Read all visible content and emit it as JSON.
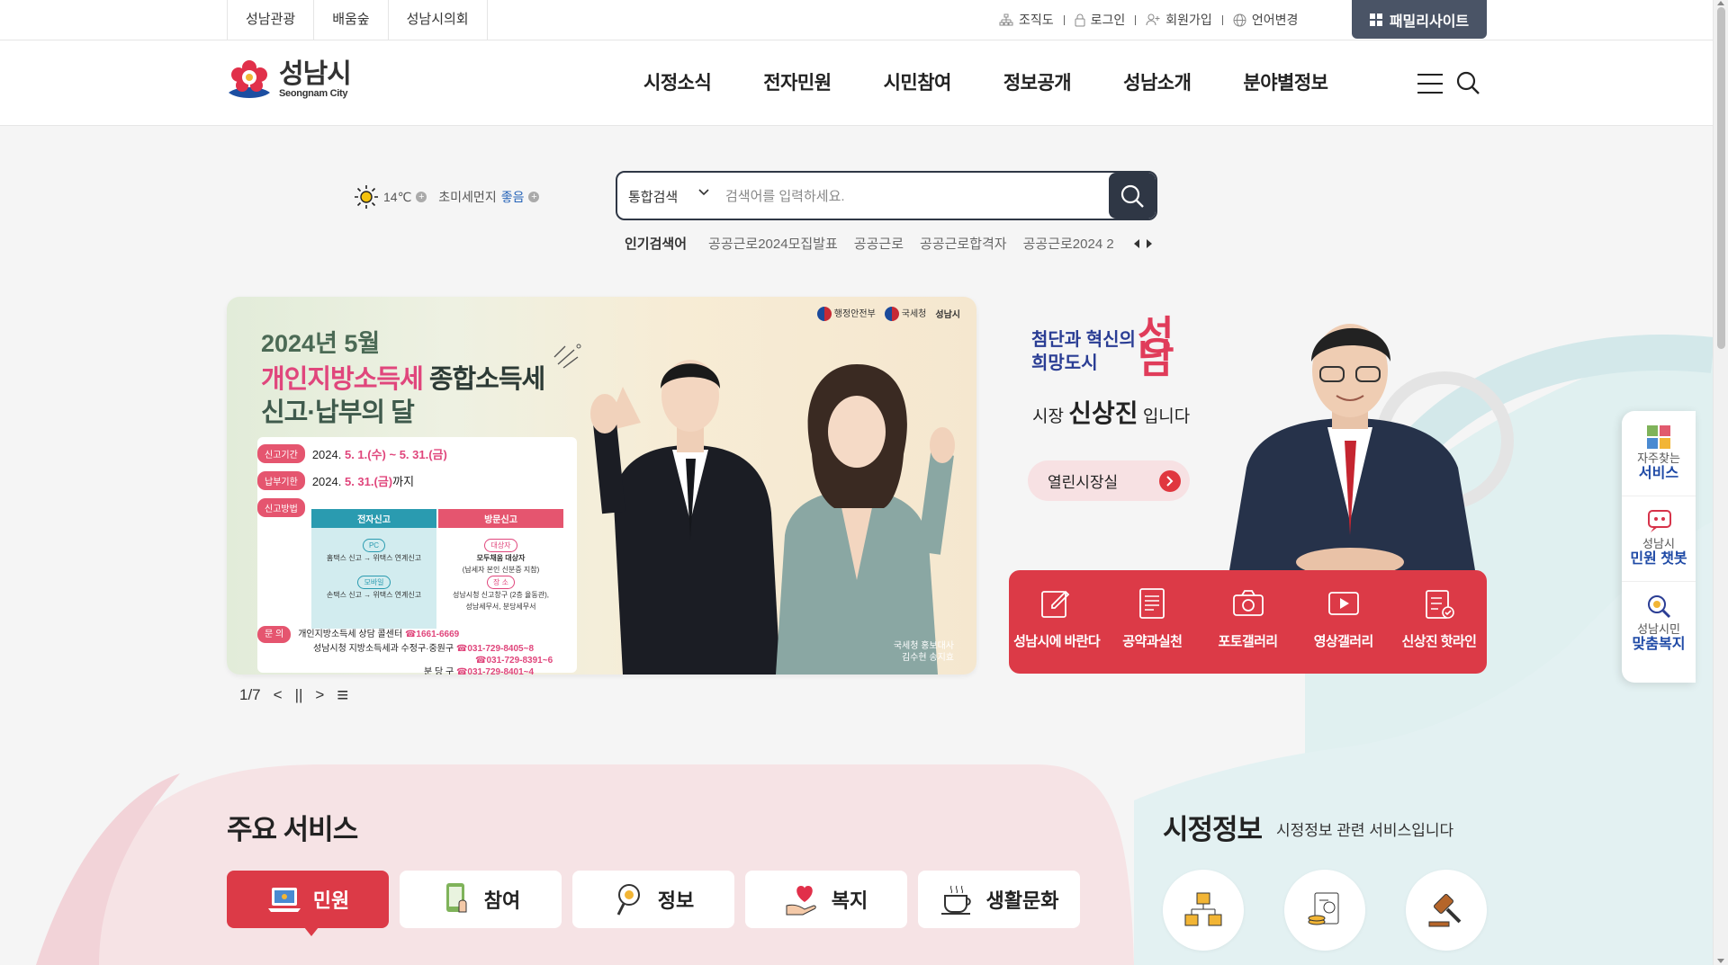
{
  "top_links": [
    "성남관광",
    "배움숲",
    "성남시의회"
  ],
  "utility": {
    "org": "조직도",
    "login": "로그인",
    "join": "회원가입",
    "language": "언어변경",
    "family_site": "패밀리사이트"
  },
  "logo": {
    "ko": "성남시",
    "en": "Seongnam City"
  },
  "gnb": [
    "시정소식",
    "전자민원",
    "시민참여",
    "정보공개",
    "성남소개",
    "분야별정보"
  ],
  "weather": {
    "temp": "14℃",
    "dust_label": "초미세먼지",
    "dust_value": "좋음"
  },
  "search": {
    "scope": "통합검색",
    "placeholder": "검색어를 입력하세요.",
    "popular_label": "인기검색어",
    "popular": [
      "공공근로2024모집발표",
      "공공근로",
      "공공근로합격자",
      "공공근로2024 2"
    ]
  },
  "banner": {
    "logos": [
      "행정안전부",
      "국세청",
      "성남시"
    ],
    "year": "2024년 5월",
    "title_hl": "개인지방소득세",
    "title_rest": " 종합소득세",
    "title2": "신고·납부의 달",
    "row1_tag": "신고기간",
    "row1_pre": "2024. ",
    "row1_hl": "5. 1.(수) ~ 5. 31.(금)",
    "row2_tag": "납부기한",
    "row2_pre": "2024. ",
    "row2_hl": "5. 31.(금)",
    "row2_post": "까지",
    "row3_tag": "신고방법",
    "col1_head": "전자신고",
    "col2_head": "방문신고",
    "col1_pc": "PC",
    "col1_pc_text": "홈택스 신고 → 위택스 연계신고",
    "col1_mobile": "모바일",
    "col1_mobile_text": "손택스 신고 → 위택스 연계신고",
    "col2_target": "대상자",
    "col2_target_text1": "모두채움 대상자",
    "col2_target_text2": "(납세자 본인 신분증 지참)",
    "col2_place": "장 소",
    "col2_place_text1": "성남시청 신고창구 (2층 율동관),",
    "col2_place_text2": "성남세무서, 분당세무서",
    "contact_tag": "문 의",
    "contact_line1": "개인지방소득세 상담 콜센터",
    "contact_tel1": "☎1661-6669",
    "contact_line2": "성남시청 지방소득세과 수정구·중원구",
    "contact_tel2": "☎031-729-8405~8",
    "contact_tel3": "☎031-729-8391~6",
    "contact_line4": "분 당 구",
    "contact_tel4": "☎031-729-8401~4",
    "caption1": "국세청 홍보대사",
    "caption2": "김수현 송지효"
  },
  "slider": {
    "counter": "1/7",
    "prev": "<",
    "pause": "||",
    "next": ">",
    "list": "≡"
  },
  "mayor": {
    "line1a": "첨단과 혁신의",
    "line1b": "희망도시",
    "big": "성남",
    "prefix": "시장",
    "name": "신상진",
    "suffix": "입니다",
    "open_office": "열린시장실"
  },
  "mayor_menu": [
    "성남시에 바란다",
    "공약과실천",
    "포토갤러리",
    "영상갤러리",
    "신상진 핫라인"
  ],
  "quick": [
    {
      "small": "자주찾는",
      "big": "서비스"
    },
    {
      "small": "성남시",
      "big": "민원 챗봇"
    },
    {
      "small": "성남시민",
      "big": "맞춤복지"
    }
  ],
  "services": {
    "title": "주요 서비스",
    "tabs": [
      "민원",
      "참여",
      "정보",
      "복지",
      "생활문화"
    ]
  },
  "city_info": {
    "title": "시정정보",
    "subtitle": "시정정보 관련 서비스입니다"
  },
  "colors": {
    "brand_red": "#dc3a47",
    "navy": "#2f3745",
    "blue": "#1f4aa6"
  }
}
